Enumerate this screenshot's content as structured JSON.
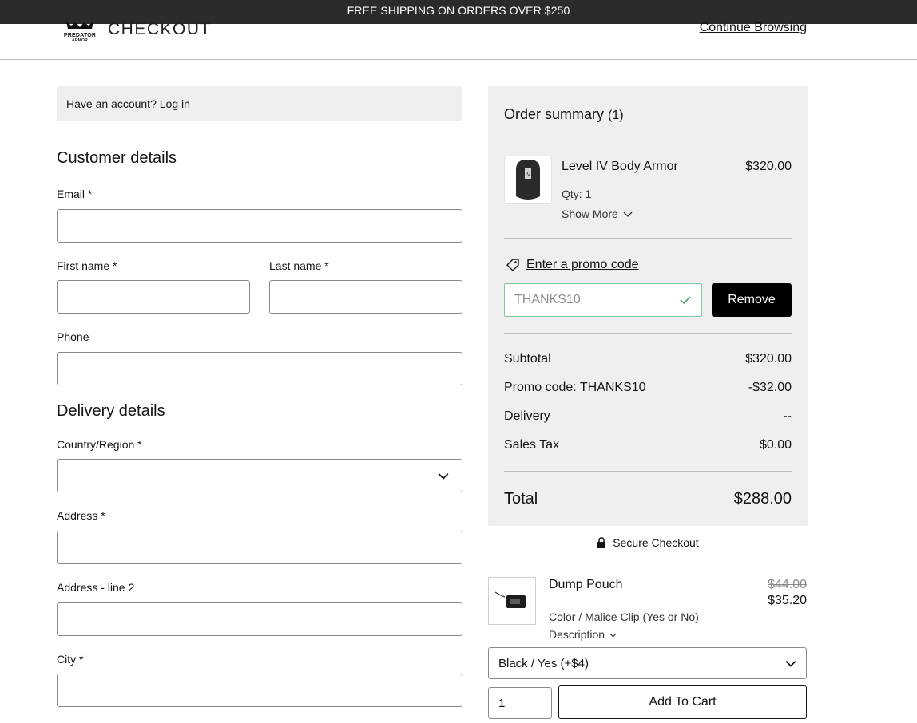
{
  "topbar": {
    "text": "FREE SHIPPING ON ORDERS OVER $250"
  },
  "header": {
    "logo_text_line1": "PREDATOR",
    "logo_text_line2": "ARMOR",
    "title": "CHECKOUT",
    "continue_label": "Continue Browsing"
  },
  "account": {
    "prompt": "Have an account?",
    "login_label": "Log in"
  },
  "customer": {
    "title": "Customer details",
    "email_label": "Email *",
    "first_name_label": "First name *",
    "last_name_label": "Last name *",
    "phone_label": "Phone"
  },
  "delivery": {
    "title": "Delivery details",
    "country_label": "Country/Region *",
    "address_label": "Address *",
    "address2_label": "Address - line 2",
    "city_label": "City *"
  },
  "summary": {
    "title": "Order summary",
    "count": "(1)",
    "item": {
      "name": "Level IV Body Armor",
      "price": "$320.00",
      "qty": "Qty: 1",
      "show_more": "Show More"
    },
    "promo_link": "Enter a promo code",
    "promo_value": "THANKS10",
    "remove_label": "Remove",
    "subtotal_label": "Subtotal",
    "subtotal_value": "$320.00",
    "promo_label": "Promo code: THANKS10",
    "promo_amount": "-$32.00",
    "delivery_label": "Delivery",
    "delivery_value": "--",
    "tax_label": "Sales Tax",
    "tax_value": "$0.00",
    "total_label": "Total",
    "total_value": "$288.00"
  },
  "secure": {
    "label": "Secure Checkout"
  },
  "upsell": {
    "name": "Dump Pouch",
    "old_price": "$44.00",
    "new_price": "$35.20",
    "option_label": "Color / Malice Clip (Yes or No)",
    "description_label": "Description",
    "variant_value": "Black / Yes (+$4)",
    "qty_value": "1",
    "add_to_cart_label": "Add To Cart"
  },
  "colors": {
    "topbar": "#2b2b2d",
    "panel": "#efefef",
    "promo_border": "#7fc99a",
    "button": "#000000"
  }
}
